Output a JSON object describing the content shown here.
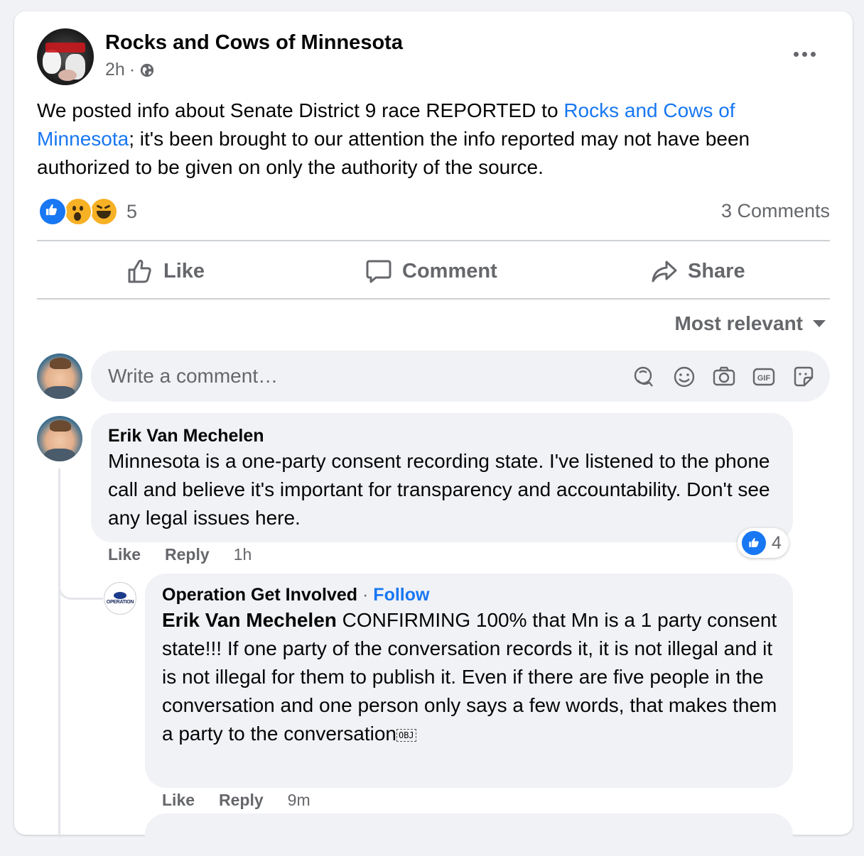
{
  "post": {
    "page_name": "Rocks and Cows of Minnesota",
    "time": "2h",
    "separator": "·",
    "text_before": "We posted info about Senate District 9 race REPORTED to ",
    "text_link": "Rocks and Cows of Minnesota",
    "text_after": "; it's been brought to our attention the info reported may not have been authorized to be given on only the authority of the source.",
    "reaction_count": "5",
    "comments_count": "3 Comments"
  },
  "actions": {
    "like": "Like",
    "comment": "Comment",
    "share": "Share"
  },
  "sort": {
    "label": "Most relevant"
  },
  "composer": {
    "placeholder": "Write a comment…"
  },
  "comments": [
    {
      "author": "Erik Van Mechelen",
      "text": "Minnesota is a one-party consent recording state. I've listened to the phone call and believe it's important for transparency and accountability. Don't see any legal issues here.",
      "like": "Like",
      "reply": "Reply",
      "time": "1h",
      "reaction_count": "4"
    },
    {
      "author": "Operation Get Involved",
      "separator": "·",
      "follow": "Follow",
      "mention": "Erik Van Mechelen",
      "text": " CONFIRMING 100% that Mn is a 1 party consent state!!! If one party of the conversation records it, it is not illegal and it is not illegal for them to publish it. Even if there are five people in the conversation and one person only says a few words, that makes them a party to the conversation",
      "obj_marker": "OBJ",
      "like": "Like",
      "reply": "Reply",
      "time": "9m",
      "avatar_text": "OPERATION"
    }
  ],
  "colors": {
    "link": "#1877f2",
    "secondary_text": "#65676b",
    "bubble": "#f0f2f5"
  },
  "icons": [
    "globe-icon",
    "more-icon",
    "like-reaction-icon",
    "wow-reaction-icon",
    "haha-reaction-icon",
    "thumbs-up-icon",
    "comment-icon",
    "share-icon",
    "caret-down-icon",
    "avatar-sticker-icon",
    "emoji-icon",
    "camera-icon",
    "gif-icon",
    "sticker-icon"
  ]
}
